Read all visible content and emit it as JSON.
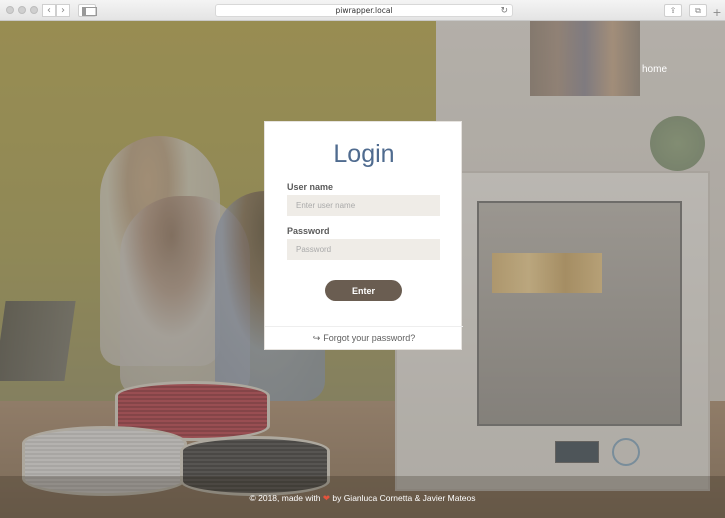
{
  "browser": {
    "url": "piwrapper.local"
  },
  "nav": {
    "home_label": "home"
  },
  "login": {
    "title": "Login",
    "username_label": "User name",
    "username_placeholder": "Enter user name",
    "password_label": "Password",
    "password_placeholder": "Password",
    "enter_label": "Enter",
    "forgot_label": "Forgot your password?"
  },
  "footer": {
    "prefix": "© 2018, made with",
    "heart": "❤",
    "suffix": "by Gianluca Cornetta & Javier Mateos"
  }
}
